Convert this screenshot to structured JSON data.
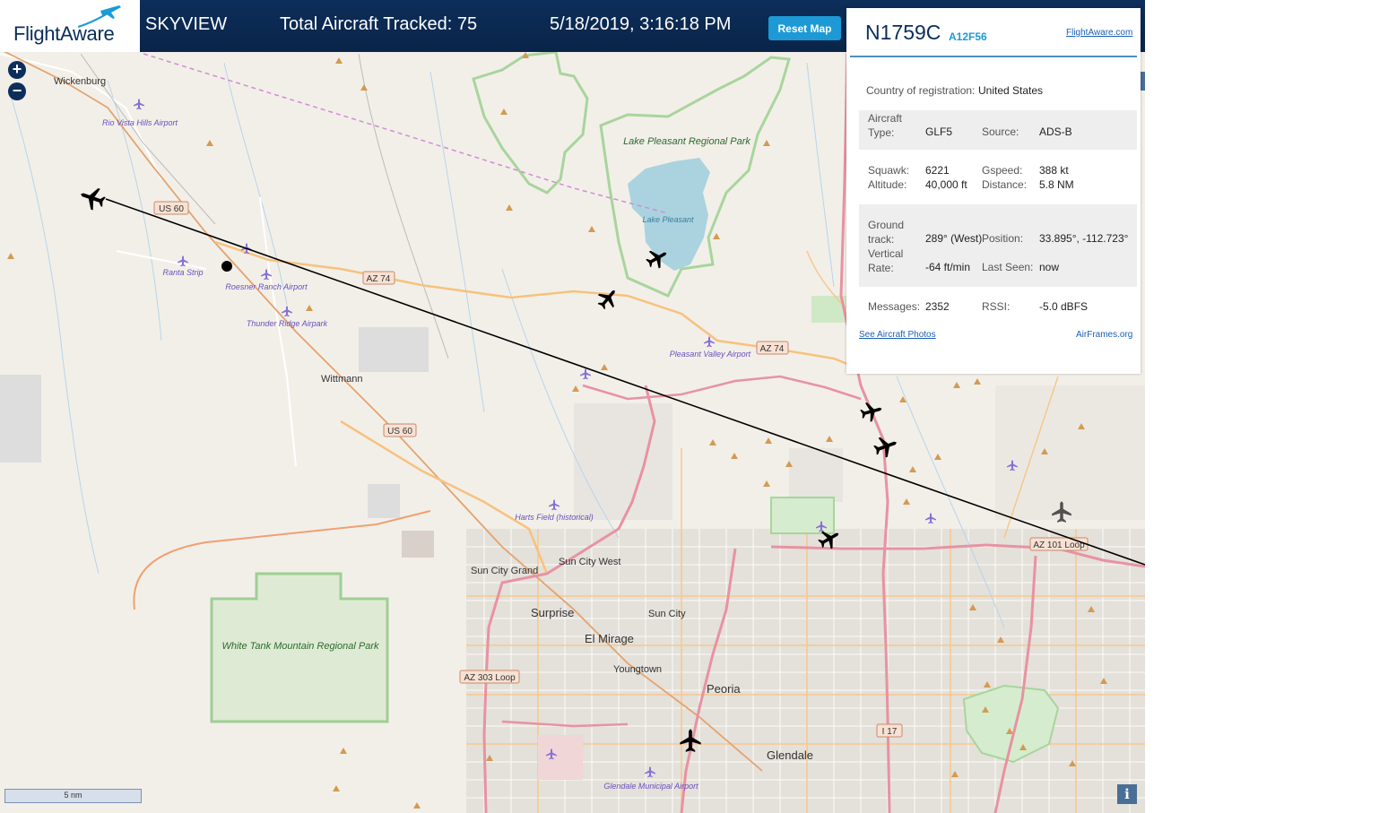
{
  "header": {
    "brand": "FlightAware",
    "title": "SKYVIEW",
    "tracked": "Total Aircraft Tracked: 75",
    "datetime": "5/18/2019, 3:16:18 PM",
    "reset_label": "Reset Map"
  },
  "map": {
    "zoom_in": "+",
    "zoom_out": "−",
    "scale_label": "5 nm",
    "info_label": "i",
    "places": [
      {
        "name": "Wickenburg"
      },
      {
        "name": "Rio Vista Hills Airport"
      },
      {
        "name": "Ranta Strip"
      },
      {
        "name": "Roesner Ranch Airport"
      },
      {
        "name": "Thunder Ridge Airpark"
      },
      {
        "name": "Wittmann"
      },
      {
        "name": "Lake Pleasant Regional Park"
      },
      {
        "name": "Lake Pleasant"
      },
      {
        "name": "Pleasant Valley Airport"
      },
      {
        "name": "Harts Field (historical)"
      },
      {
        "name": "Sun City Grand"
      },
      {
        "name": "Sun City West"
      },
      {
        "name": "Surprise"
      },
      {
        "name": "Sun City"
      },
      {
        "name": "El Mirage"
      },
      {
        "name": "Youngtown"
      },
      {
        "name": "Peoria"
      },
      {
        "name": "Glendale"
      },
      {
        "name": "Glendale Municipal Airport"
      },
      {
        "name": "White Tank Mountain Regional Park"
      }
    ],
    "road_shields": [
      "US 60",
      "AZ 74",
      "AZ 74",
      "US 60",
      "AZ 101 Loop",
      "AZ 303 Loop",
      "I 17"
    ]
  },
  "panel": {
    "registration": "N1759C",
    "hex": "A12F56",
    "site_link": "FlightAware.com",
    "country_label": "Country of registration:",
    "country_value": "United States",
    "aircraft_type_label": "Aircraft Type:",
    "aircraft_type_value": "GLF5",
    "source_label": "Source:",
    "source_value": "ADS-B",
    "squawk_label": "Squawk:",
    "squawk_value": "6221",
    "altitude_label": "Altitude:",
    "altitude_value": "40,000 ft",
    "gspeed_label": "Gspeed:",
    "gspeed_value": "388 kt",
    "distance_label": "Distance:",
    "distance_value": "5.8 NM",
    "ground_track_label": "Ground track:",
    "ground_track_value": "289° (West)",
    "position_label": "Position:",
    "position_value": "33.895°, -112.723°",
    "vertical_rate_label": "Vertical Rate:",
    "vertical_rate_value": "-64 ft/min",
    "last_seen_label": "Last Seen:",
    "last_seen_value": "now",
    "messages_label": "Messages:",
    "messages_value": "2352",
    "rssi_label": "RSSI:",
    "rssi_value": "-5.0 dBFS",
    "photos_link": "See Aircraft Photos",
    "airframes_link": "AirFrames.org"
  }
}
